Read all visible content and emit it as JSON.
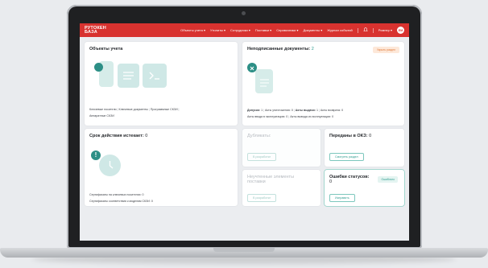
{
  "app": {
    "logo_line1": "РУТОКЕН",
    "logo_line2": "БАЗА"
  },
  "nav": {
    "items": [
      "Объекты учета ▾",
      "Утилиты ▾",
      "Сотрудники ▾",
      "Поставки ▾",
      "Справочники ▾",
      "Документы ▾",
      "Журнал событий"
    ],
    "user": "Ромнер ▾",
    "avatar": "ЕМ"
  },
  "cards": {
    "objects": {
      "title": "Объекты учета",
      "links": [
        "Ключевые носители",
        "Ключевые документы",
        "Программные СКЗИ",
        "Аппаратные СКЗИ"
      ]
    },
    "unsigned": {
      "title": "Неподписанные документы:",
      "count": "2",
      "badge": "Укрыть раздел",
      "stats_row1": [
        {
          "label": "Допуски:",
          "value": "1",
          "bold": true
        },
        {
          "label": "Акты уничтожения:",
          "value": "0",
          "bold": false
        },
        {
          "label": "Акты выдачи:",
          "value": "1",
          "bold": true
        },
        {
          "label": "Акты возврата:",
          "value": "0",
          "bold": false
        }
      ],
      "stats_row2": [
        {
          "label": "Акты ввода в эксплуатацию:",
          "value": "0"
        },
        {
          "label": "Акты вывода из эксплуатации:",
          "value": "0"
        }
      ]
    },
    "expiry": {
      "title": "Срок действия истекает:",
      "count": "0",
      "line1": "Сертификаты на ключевых носителях: 0",
      "line2": "Сертификаты соответствия к моделям СКЗИ: 0"
    },
    "duplicates": {
      "title": "Дубликаты:",
      "button": "В разработке"
    },
    "unaccounted": {
      "title": "Неучтенные элементы поставки",
      "button": "В разработке"
    },
    "transferred": {
      "title": "Переданы в ОКЗ:",
      "count": "0",
      "button": "Смотреть раздел"
    },
    "errors": {
      "title": "Ошибки статусов:",
      "count": "0",
      "badge": "Ошибочно",
      "button": "Исправить"
    }
  },
  "colors": {
    "brand": "#d8322f",
    "accent": "#2d9c8f",
    "tile": "#cfe8e6"
  }
}
